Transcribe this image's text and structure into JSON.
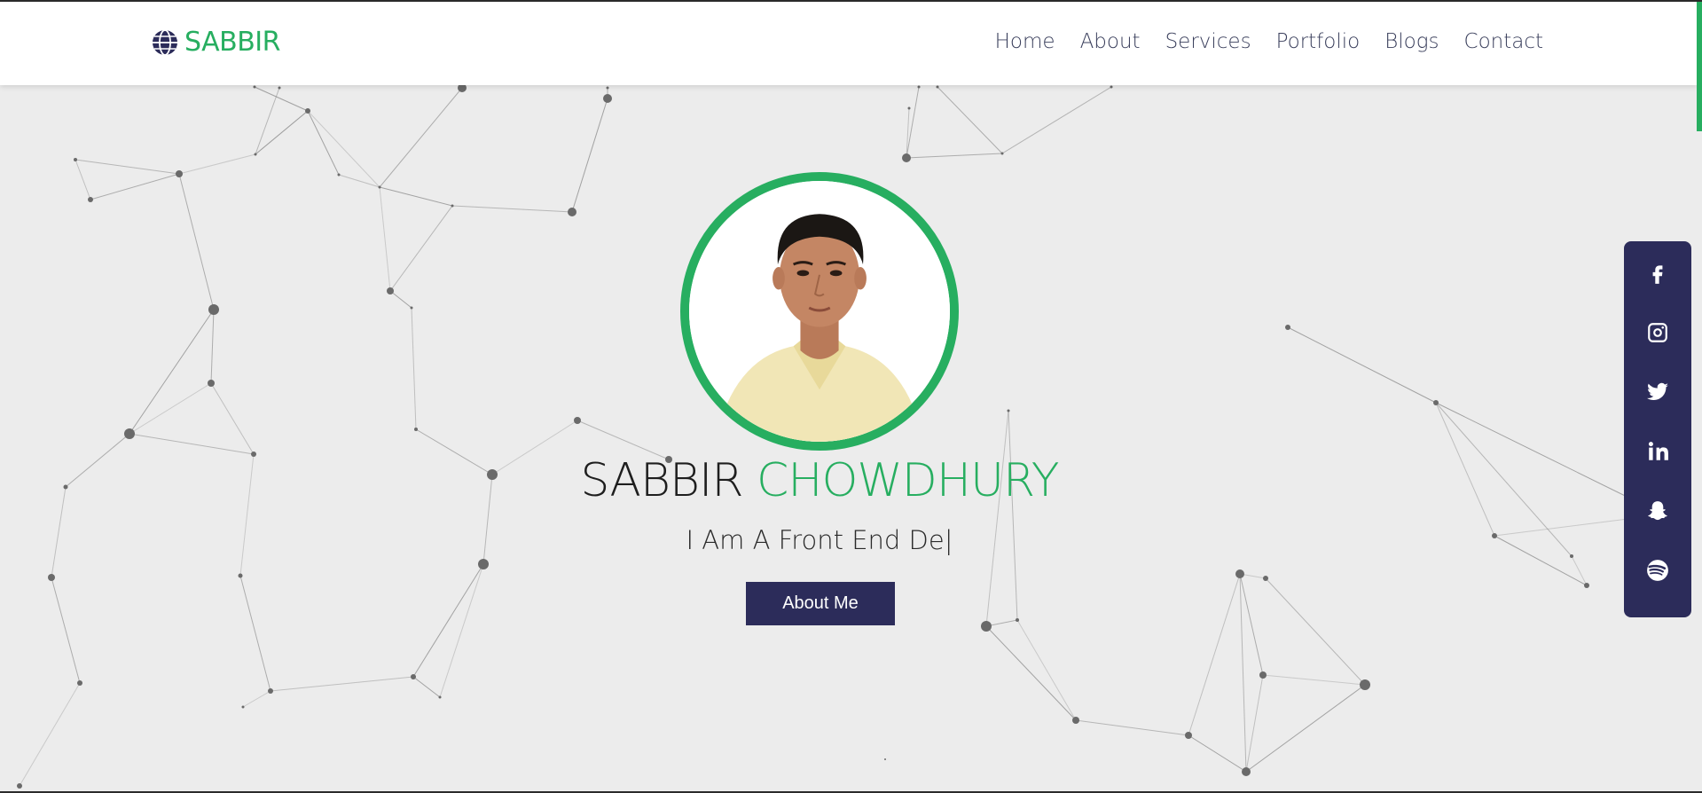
{
  "nav": {
    "brand": "SABBIR",
    "brand_icon": "globe-icon",
    "links": [
      "Home",
      "About",
      "Services",
      "Portfolio",
      "Blogs",
      "Contact"
    ]
  },
  "hero": {
    "name_first": "SABBIR",
    "name_last": "CHOWDHURY",
    "typed_text": "I Am A Front End De|",
    "button_label": "About Me"
  },
  "social": [
    "facebook-icon",
    "instagram-icon",
    "twitter-icon",
    "linkedin-icon",
    "snapchat-icon",
    "spotify-icon"
  ],
  "colors": {
    "accent": "#27ae60",
    "navy": "#2c2c5a",
    "background": "#ececec",
    "nav_text": "#3a3f5c"
  }
}
